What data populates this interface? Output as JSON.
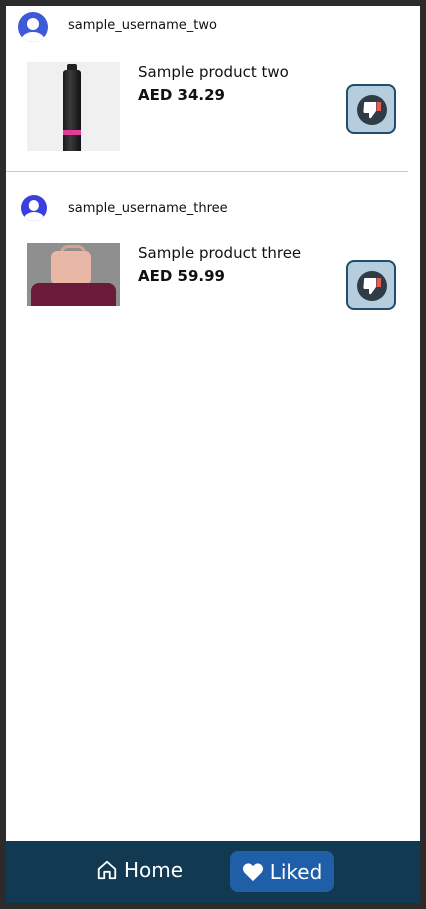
{
  "posts": [
    {
      "username": "sample_username_two",
      "product_name": "Sample product two",
      "price": "AED 34.29"
    },
    {
      "username": "sample_username_three",
      "product_name": "Sample product three",
      "price": "AED 59.99"
    }
  ],
  "nav": {
    "home_label": "Home",
    "liked_label": "Liked",
    "active": "Liked"
  },
  "colors": {
    "navbar_bg": "#113a52",
    "active_tab_bg": "#1f5fa7",
    "dislike_button_bg": "#b5cddd",
    "dislike_accent": "#e85a4f"
  },
  "icons": {
    "avatar": "user-avatar-icon",
    "dislike": "thumbs-down-icon",
    "home": "home-icon",
    "liked": "heart-icon"
  }
}
